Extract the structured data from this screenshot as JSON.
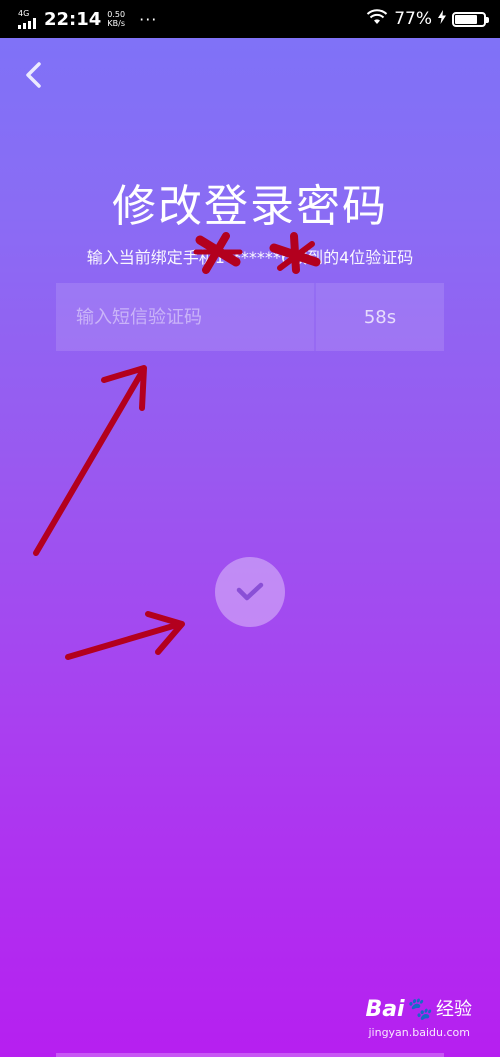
{
  "status_bar": {
    "network": "4G",
    "time": "22:14",
    "speed_value": "0.50",
    "speed_unit": "KB/s",
    "more": "···",
    "battery": "77%",
    "battery_level": 0.77
  },
  "page": {
    "title": "修改登录密码",
    "hint": "输入当前绑定手机1*******6收到的4位验证码"
  },
  "code_input": {
    "placeholder": "输入短信验证码",
    "value": ""
  },
  "countdown": "58s",
  "icons": {
    "back": "chevron-left-icon",
    "confirm": "check-icon",
    "wifi": "wifi-icon",
    "battery": "battery-icon",
    "charging": "bolt-icon"
  },
  "colors": {
    "gradient_top": "#7d73f8",
    "gradient_bottom": "#b61ff0",
    "annotation": "#b3001e"
  },
  "watermark": {
    "logo": "Bai🐾",
    "text": "经验",
    "url": "jingyan.baidu.com"
  }
}
